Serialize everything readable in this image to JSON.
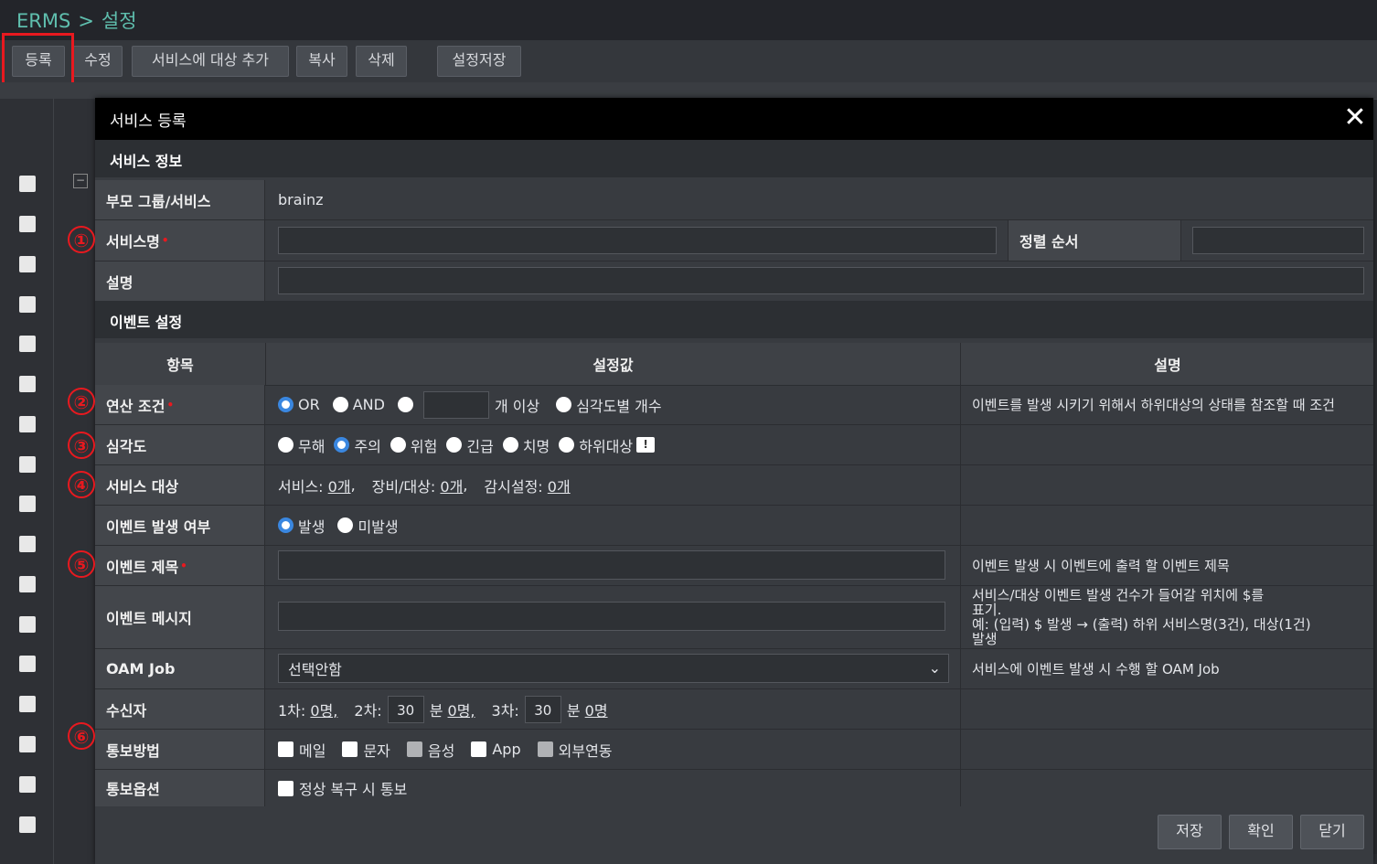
{
  "breadcrumb": {
    "root": "ERMS",
    "separator": ">",
    "current": "설정"
  },
  "toolbar": {
    "register": "등록",
    "edit": "수정",
    "add_target": "서비스에 대상 추가",
    "copy": "복사",
    "delete": "삭제",
    "save_settings": "설정저장"
  },
  "modal": {
    "title": "서비스 등록",
    "section_service": "서비스 정보",
    "section_event": "이벤트 설정",
    "parent_label": "부모 그룹/서비스",
    "parent_value": "brainz",
    "service_name_label": "서비스명",
    "sort_order_label": "정렬 순서",
    "description_label": "설명",
    "table_headers": {
      "item": "항목",
      "value": "설정값",
      "desc": "설명"
    },
    "operation": {
      "label": "연산 조건",
      "opt_or": "OR",
      "opt_and": "AND",
      "count_suffix": "개 이상",
      "opt_severity_count": "심각도별 개수",
      "desc": "이벤트를 발생 시키기 위해서 하위대상의 상태를 참조할 때 조건"
    },
    "severity": {
      "label": "심각도",
      "options": [
        "무해",
        "주의",
        "위험",
        "긴급",
        "치명",
        "하위대상"
      ],
      "badge": "!"
    },
    "target": {
      "label": "서비스 대상",
      "service_prefix": "서비스:",
      "service_count": "0개",
      "device_prefix": "장비/대상:",
      "device_count": "0개",
      "monitor_prefix": "감시설정:",
      "monitor_count": "0개"
    },
    "occurrence": {
      "label": "이벤트 발생 여부",
      "opt_yes": "발생",
      "opt_no": "미발생"
    },
    "event_title": {
      "label": "이벤트 제목",
      "desc": "이벤트 발생 시 이벤트에 출력 할 이벤트 제목"
    },
    "event_message": {
      "label": "이벤트 메시지",
      "desc_line1": "서비스/대상 이벤트 발생 건수가 들어갈 위치에 $를",
      "desc_line2": "표기.",
      "desc_line3": "예: (입력) $ 발생 → (출력) 하위 서비스명(3건), 대상(1건)",
      "desc_line4": "발생"
    },
    "oam": {
      "label": "OAM Job",
      "selected": "선택안함",
      "desc": "서비스에 이벤트 발생 시 수행 할 OAM Job"
    },
    "receiver": {
      "label": "수신자",
      "first_prefix": "1차:",
      "first_count": "0명,",
      "second_prefix": "2차:",
      "second_minutes": "30",
      "minute_unit": "분",
      "second_count": "0명,",
      "third_prefix": "3차:",
      "third_minutes": "30",
      "third_count": "0명"
    },
    "notify_method": {
      "label": "통보방법",
      "options": [
        "메일",
        "문자",
        "음성",
        "App",
        "외부연동"
      ]
    },
    "notify_option": {
      "label": "통보옵션",
      "recovery": "정상 복구 시 통보"
    },
    "buttons": {
      "save": "저장",
      "confirm": "확인",
      "close": "닫기"
    }
  },
  "callouts": [
    "①",
    "②",
    "③",
    "④",
    "⑤",
    "⑥"
  ],
  "colors": {
    "accent": "#3a87e0",
    "highlight": "#e8191f",
    "brand": "#5fbfae"
  }
}
